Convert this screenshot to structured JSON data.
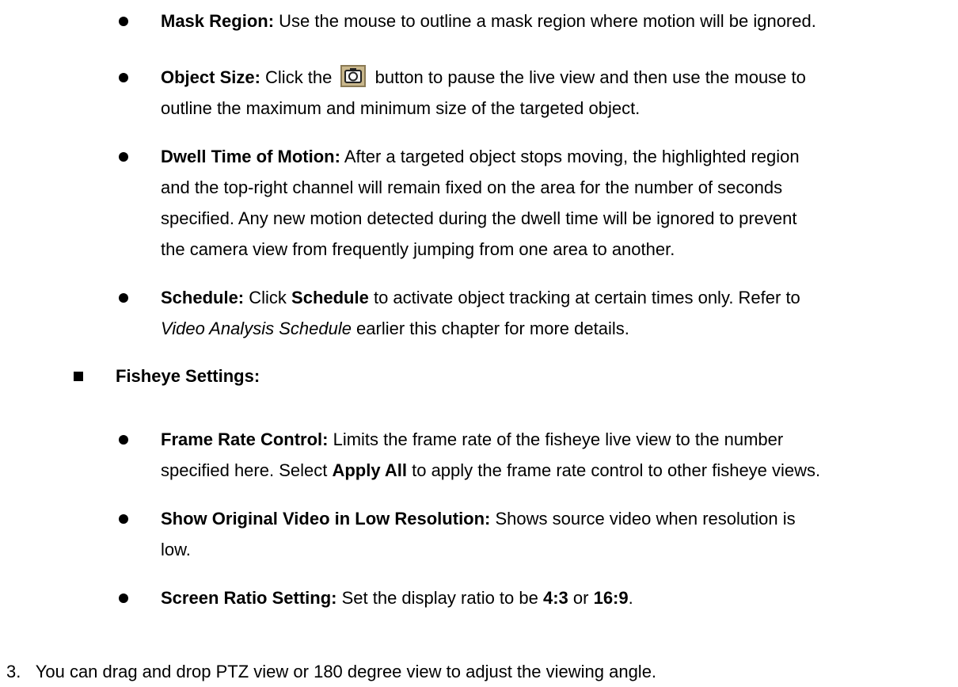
{
  "items": [
    {
      "term": "Mask Region:",
      "text": " Use the mouse to outline a mask region where motion will be ignored."
    },
    {
      "term": "Object Size:",
      "text_a": " Click the ",
      "text_b": " button to pause the live view and then use the mouse to",
      "line2": "outline the maximum and minimum size of the targeted object.",
      "icon": "camera-icon"
    },
    {
      "term": "Dwell Time of Motion:",
      "text": " After a targeted object stops moving, the highlighted region",
      "line2": "and the top-right channel will remain fixed on the area for the number of seconds",
      "line3": "specified. Any new motion detected during the dwell time will be ignored to prevent",
      "line4": "the camera view from frequently jumping from one area to another."
    },
    {
      "term": "Schedule:",
      "text_a": " Click ",
      "bold": "Schedule",
      "text_b": " to activate object tracking at certain times only. Refer to",
      "line2_italic": "Video Analysis Schedule",
      "line2_rest": " earlier this chapter for more details."
    }
  ],
  "section": {
    "title": "Fisheye Settings:"
  },
  "fisheye": [
    {
      "term": "Frame Rate Control:",
      "text": " Limits the frame rate of the fisheye live view to the number",
      "line2_a": "specified here. Select ",
      "line2_bold": "Apply All",
      "line2_b": " to apply the frame rate control to other fisheye views."
    },
    {
      "term": "Show Original Video in Low Resolution:",
      "text": " Shows source video when resolution is",
      "line2": "low."
    },
    {
      "term": "Screen Ratio Setting:",
      "text_a": " Set the display ratio to be ",
      "bold1": "4:3",
      "text_b": " or ",
      "bold2": "16:9",
      "text_c": "."
    }
  ],
  "step": {
    "number": "3.",
    "text": "You can drag and drop PTZ view or 180 degree view to adjust the viewing angle."
  }
}
